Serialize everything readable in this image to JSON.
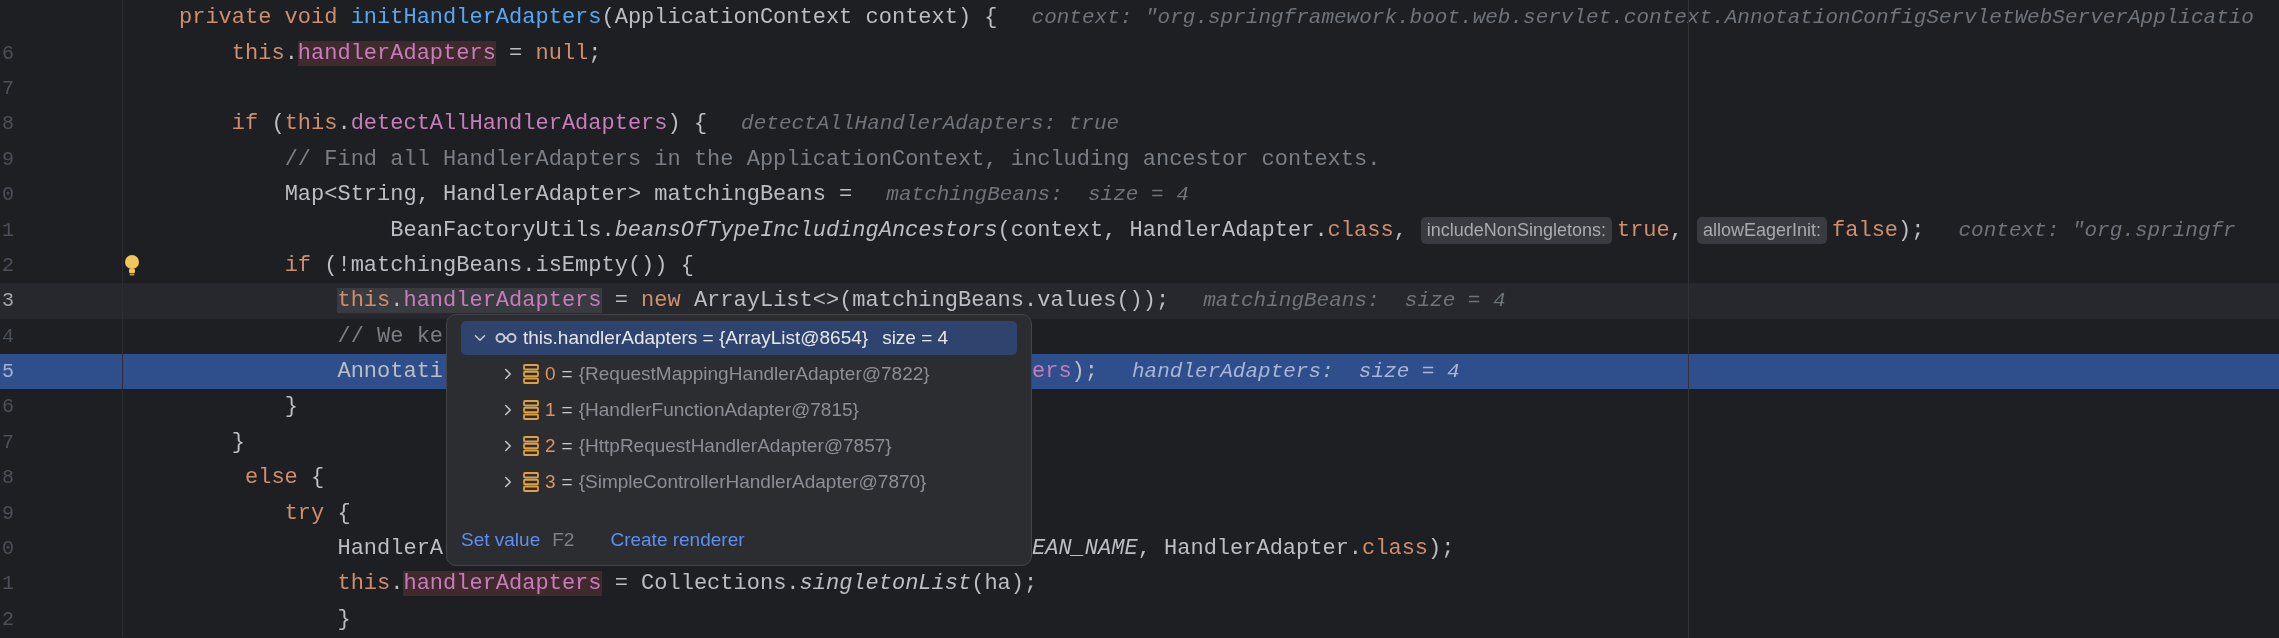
{
  "editor": {
    "rows": [
      {
        "current": false,
        "selected": false,
        "bulb": false,
        "parts": [
          {
            "kind": "code",
            "tokens": [
              {
                "kind": "keyword",
                "text": "private void ",
                "highlighted": false
              },
              {
                "kind": "method",
                "text": "initHandlerAdapters",
                "highlighted": false
              },
              {
                "kind": "plain",
                "text": "(ApplicationContext context) {",
                "highlighted": false
              }
            ]
          },
          {
            "kind": "hint",
            "text": "context: \"org.springframework.boot.web.servlet.context.AnnotationConfigServletWebServerApplicatio"
          }
        ]
      },
      {
        "number": "6",
        "current": false,
        "selected": false,
        "bulb": false,
        "parts": [
          {
            "kind": "code",
            "tokens": [
              {
                "kind": "keyword",
                "text": "    this",
                "highlighted": false
              },
              {
                "kind": "plain",
                "text": ".",
                "highlighted": false
              },
              {
                "kind": "field",
                "text": "handlerAdapters",
                "highlighted": true
              },
              {
                "kind": "plain",
                "text": " = ",
                "highlighted": false
              },
              {
                "kind": "keyword",
                "text": "null",
                "highlighted": false
              },
              {
                "kind": "plain",
                "text": ";",
                "highlighted": false
              }
            ]
          }
        ]
      },
      {
        "number": "7",
        "current": false,
        "selected": false,
        "bulb": false,
        "parts": []
      },
      {
        "number": "8",
        "current": false,
        "selected": false,
        "bulb": false,
        "parts": [
          {
            "kind": "code",
            "tokens": [
              {
                "kind": "keyword",
                "text": "    if ",
                "highlighted": false
              },
              {
                "kind": "plain",
                "text": "(",
                "highlighted": false
              },
              {
                "kind": "keyword",
                "text": "this",
                "highlighted": false
              },
              {
                "kind": "plain",
                "text": ".",
                "highlighted": false
              },
              {
                "kind": "field",
                "text": "detectAllHandlerAdapters",
                "highlighted": false
              },
              {
                "kind": "plain",
                "text": ") {",
                "highlighted": false
              }
            ]
          },
          {
            "kind": "hint",
            "text": "detectAllHandlerAdapters: true"
          }
        ]
      },
      {
        "number": "9",
        "current": false,
        "selected": false,
        "bulb": false,
        "parts": [
          {
            "kind": "code",
            "tokens": [
              {
                "kind": "comment",
                "text": "        // Find all HandlerAdapters in the ApplicationContext, including ancestor contexts.",
                "highlighted": false
              }
            ]
          }
        ]
      },
      {
        "number": "0",
        "current": false,
        "selected": false,
        "bulb": false,
        "parts": [
          {
            "kind": "code",
            "tokens": [
              {
                "kind": "plain",
                "text": "        Map<String, HandlerAdapter> matchingBeans =",
                "highlighted": false
              }
            ]
          },
          {
            "kind": "hint",
            "text": "matchingBeans:  size = 4"
          }
        ]
      },
      {
        "number": "1",
        "current": false,
        "selected": false,
        "bulb": false,
        "parts": [
          {
            "kind": "code",
            "tokens": [
              {
                "kind": "plain",
                "text": "                BeanFactoryUtils.",
                "highlighted": false
              },
              {
                "kind": "static",
                "text": "beansOfTypeIncludingAncestors",
                "highlighted": false
              },
              {
                "kind": "plain",
                "text": "(context, HandlerAdapter.",
                "highlighted": false
              },
              {
                "kind": "keyword",
                "text": "class",
                "highlighted": false
              },
              {
                "kind": "plain",
                "text": ",",
                "highlighted": false
              }
            ]
          },
          {
            "kind": "param",
            "text": "includeNonSingletons:"
          },
          {
            "kind": "code",
            "tokens": [
              {
                "kind": "keyword",
                "text": "true",
                "highlighted": false
              },
              {
                "kind": "plain",
                "text": ",",
                "highlighted": false
              }
            ]
          },
          {
            "kind": "param",
            "text": "allowEagerInit:"
          },
          {
            "kind": "code",
            "tokens": [
              {
                "kind": "keyword",
                "text": "false",
                "highlighted": false
              },
              {
                "kind": "plain",
                "text": ");",
                "highlighted": false
              }
            ]
          },
          {
            "kind": "hint",
            "text": "context: \"org.springfr"
          }
        ]
      },
      {
        "number": "2",
        "current": false,
        "selected": false,
        "bulb": true,
        "parts": [
          {
            "kind": "code",
            "tokens": [
              {
                "kind": "keyword",
                "text": "        if ",
                "highlighted": false
              },
              {
                "kind": "plain",
                "text": "(!matchingBeans.isEmpty()) {",
                "highlighted": false
              }
            ]
          }
        ]
      },
      {
        "number": "3",
        "current": true,
        "selected": false,
        "bulb": false,
        "parts": [
          {
            "kind": "code",
            "tokens": [
              {
                "kind": "keyword",
                "text": "            this",
                "highlighted": true
              },
              {
                "kind": "plain",
                "text": ".",
                "highlighted": true
              },
              {
                "kind": "field",
                "text": "handlerAdapters",
                "highlighted": true
              },
              {
                "kind": "plain",
                "text": " = ",
                "highlighted": false
              },
              {
                "kind": "keyword",
                "text": "new ",
                "highlighted": false
              },
              {
                "kind": "plain",
                "text": "ArrayList<>(matchingBeans.values());",
                "highlighted": false
              }
            ]
          },
          {
            "kind": "hint",
            "text": "matchingBeans:  size = 4"
          }
        ]
      },
      {
        "number": "4",
        "current": false,
        "selected": false,
        "bulb": false,
        "parts": [
          {
            "kind": "code",
            "tokens": [
              {
                "kind": "comment",
                "text": "            // We ke",
                "highlighted": false
              }
            ]
          }
        ]
      },
      {
        "number": "5",
        "current": false,
        "selected": true,
        "bulb": false,
        "parts": [
          {
            "kind": "code",
            "tokens": [
              {
                "kind": "plain",
                "text": "            Annotati",
                "highlighted": false
              }
            ]
          }
        ],
        "after": [
          {
            "kind": "code",
            "tokens": [
              {
                "kind": "field",
                "text": "ers",
                "highlighted": false
              },
              {
                "kind": "plain",
                "text": ");",
                "highlighted": false
              }
            ]
          },
          {
            "kind": "hint",
            "text": "handlerAdapters:  size = 4"
          }
        ]
      },
      {
        "number": "6",
        "current": false,
        "selected": false,
        "bulb": false,
        "parts": [
          {
            "kind": "code",
            "tokens": [
              {
                "kind": "plain",
                "text": "        }",
                "highlighted": false
              }
            ]
          }
        ]
      },
      {
        "number": "7",
        "current": false,
        "selected": false,
        "bulb": false,
        "parts": [
          {
            "kind": "code",
            "tokens": [
              {
                "kind": "plain",
                "text": "    }",
                "highlighted": false
              }
            ]
          }
        ]
      },
      {
        "number": "8",
        "current": false,
        "selected": false,
        "bulb": false,
        "parts": [
          {
            "kind": "code",
            "tokens": [
              {
                "kind": "keyword",
                "text": "     else ",
                "highlighted": false
              },
              {
                "kind": "plain",
                "text": "{",
                "highlighted": false
              }
            ]
          }
        ]
      },
      {
        "number": "9",
        "current": false,
        "selected": false,
        "bulb": false,
        "parts": [
          {
            "kind": "code",
            "tokens": [
              {
                "kind": "keyword",
                "text": "        try ",
                "highlighted": false
              },
              {
                "kind": "plain",
                "text": "{",
                "highlighted": false
              }
            ]
          }
        ]
      },
      {
        "number": "0",
        "current": false,
        "selected": false,
        "bulb": false,
        "parts": [
          {
            "kind": "code",
            "tokens": [
              {
                "kind": "plain",
                "text": "            HandlerA",
                "highlighted": false
              }
            ]
          }
        ],
        "after": [
          {
            "kind": "code",
            "tokens": [
              {
                "kind": "static",
                "text": "EAN_NAME",
                "highlighted": false
              },
              {
                "kind": "plain",
                "text": ", HandlerAdapter.",
                "highlighted": false
              },
              {
                "kind": "keyword",
                "text": "class",
                "highlighted": false
              },
              {
                "kind": "plain",
                "text": ");",
                "highlighted": false
              }
            ]
          }
        ]
      },
      {
        "number": "1",
        "current": false,
        "selected": false,
        "bulb": false,
        "parts": [
          {
            "kind": "code",
            "tokens": [
              {
                "kind": "keyword",
                "text": "            this",
                "highlighted": false
              },
              {
                "kind": "plain",
                "text": ".",
                "highlighted": false
              },
              {
                "kind": "field",
                "text": "handlerAdapters",
                "highlighted": true
              },
              {
                "kind": "plain",
                "text": " = Collections.",
                "highlighted": false
              },
              {
                "kind": "static",
                "text": "singletonList",
                "highlighted": false
              },
              {
                "kind": "plain",
                "text": "(ha);",
                "highlighted": false
              }
            ]
          }
        ]
      },
      {
        "number": "2",
        "current": false,
        "selected": false,
        "bulb": false,
        "parts": [
          {
            "kind": "code",
            "tokens": [
              {
                "kind": "plain",
                "text": "            }",
                "highlighted": false
              }
            ]
          }
        ]
      }
    ]
  },
  "debug_popup": {
    "header": {
      "text": "this.handlerAdapters = {ArrayList@8654}",
      "size": "size = 4",
      "expanded": true,
      "selected": true
    },
    "children": [
      {
        "name": "0",
        "operator": "=",
        "value": "{RequestMappingHandlerAdapter@7822}",
        "expanded": false,
        "selected": false
      },
      {
        "name": "1",
        "operator": "=",
        "value": "{HandlerFunctionAdapter@7815}",
        "expanded": false,
        "selected": false
      },
      {
        "name": "2",
        "operator": "=",
        "value": "{HttpRequestHandlerAdapter@7857}",
        "expanded": false,
        "selected": false
      },
      {
        "name": "3",
        "operator": "=",
        "value": "{SimpleControllerHandlerAdapter@7870}",
        "expanded": false,
        "selected": false
      }
    ],
    "actions": [
      {
        "label": "Set value",
        "shortcut": "F2"
      },
      {
        "label": "Create renderer"
      }
    ]
  }
}
